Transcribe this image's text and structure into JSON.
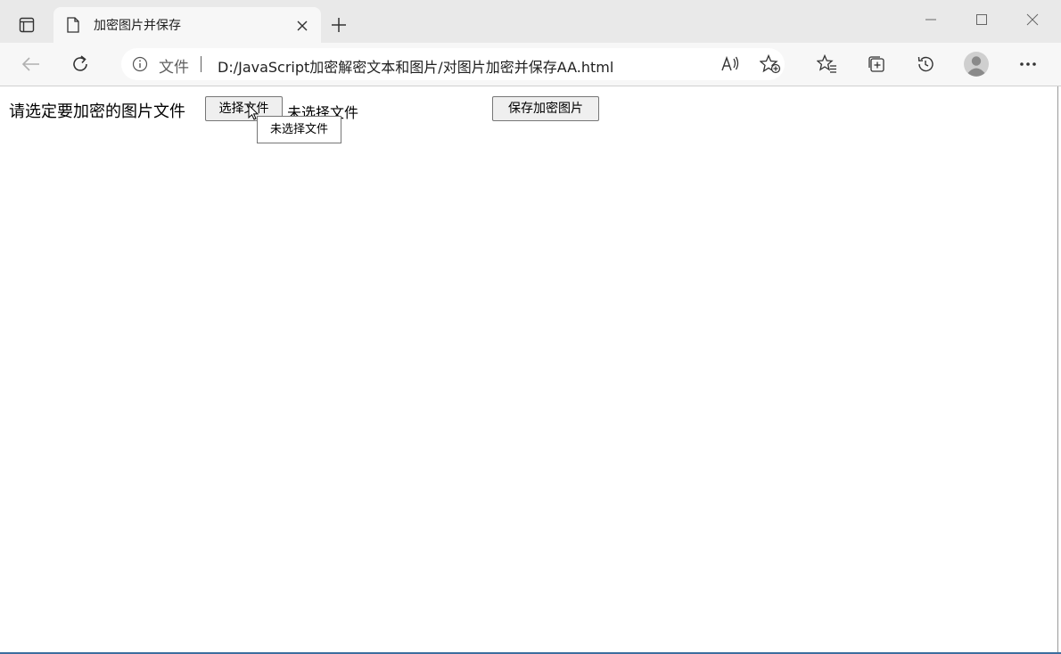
{
  "tab": {
    "title": "加密图片并保存"
  },
  "toolbar": {
    "address_label": "文件",
    "url": "D:/JavaScript加密解密文本和图片/对图片加密并保存AA.html"
  },
  "page": {
    "prompt": "请选定要加密的图片文件",
    "choose_button": "选择文件",
    "file_status": "未选择文件",
    "save_button": "保存加密图片",
    "tooltip": "未选择文件"
  },
  "icons": {
    "tab_actions": "tab-actions-icon",
    "tab_doc": "document-icon",
    "tab_close": "close-icon",
    "new_tab": "plus-icon",
    "back": "back-arrow-icon",
    "refresh": "refresh-icon",
    "info": "info-icon",
    "read_aloud": "read-aloud-icon",
    "add_favorite": "add-favorite-icon",
    "favorites": "favorites-icon",
    "collections": "collections-icon",
    "history": "history-icon",
    "profile": "profile-avatar-icon",
    "menu": "more-menu-icon"
  },
  "colors": {
    "tabstrip_bg": "#e9e9e9",
    "toolbar_bg": "#f7f7f7",
    "button_bg": "#efefef",
    "button_border": "#767676"
  }
}
